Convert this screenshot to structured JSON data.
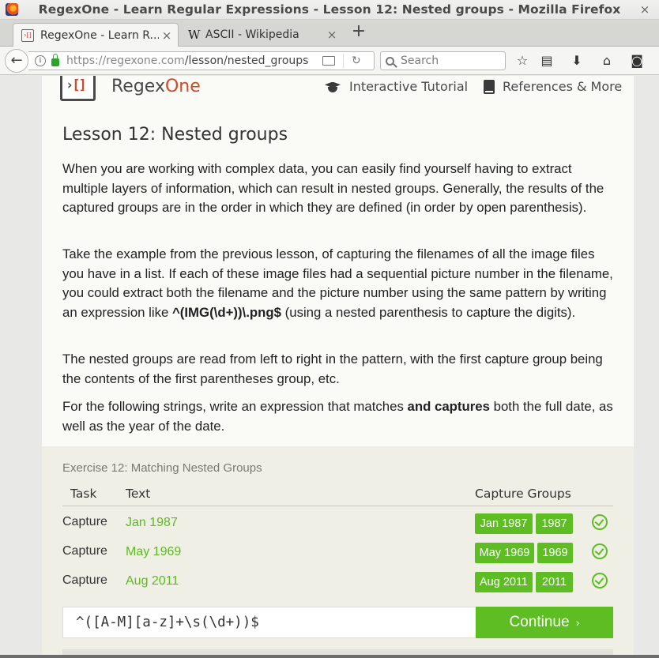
{
  "window": {
    "title": "RegexOne - Learn Regular Expressions - Lesson 12: Nested groups - Mozilla Firefox",
    "close_glyph": "×"
  },
  "tabs": [
    {
      "label": "RegexOne - Learn R...",
      "favicon": "regexone-favicon",
      "close": "×"
    },
    {
      "label": "ASCII - Wikipedia",
      "favicon": "wikipedia-favicon",
      "favicon_text": "W",
      "close": "×"
    }
  ],
  "new_tab_label": "+",
  "navbar": {
    "back_glyph": "←",
    "url_host": "https://regexone.com",
    "url_path": "/lesson/nested_groups",
    "reload_glyph": "↻",
    "search_placeholder": "Search"
  },
  "toolbar_icons": [
    "star-icon",
    "reading-list-icon",
    "download-icon",
    "home-icon",
    "pocket-icon"
  ],
  "site": {
    "logo_glyph": "›[]",
    "brand_regex": "Regex",
    "brand_one": "One",
    "nav_tutorial": "Interactive Tutorial",
    "nav_references": "References & More"
  },
  "lesson": {
    "title": "Lesson 12: Nested groups",
    "p1": "When you are working with complex data, you can easily find yourself having to extract multiple layers of information, which can result in nested groups. Generally, the results of the captured groups are in the order in which they are defined (in order by open parenthesis).",
    "p2_a": "Take the example from the previous lesson, of capturing the filenames of all the image files you have in a list. If each of these image files had a sequential picture number in the filename, you could extract both the filename and the picture number using the same pattern by writing an expression like ",
    "p2_code": "^(IMG(\\d+))\\.png$",
    "p2_b": " (using a nested parenthesis to capture the digits).",
    "p3": "The nested groups are read from left to right in the pattern, with the first capture group being the contents of the first parentheses group, etc.",
    "p4_a": "For the following strings, write an expression that matches ",
    "p4_bold": "and captures",
    "p4_b": " both the full date, as well as the year of the date."
  },
  "exercise": {
    "title": "Exercise 12: Matching Nested Groups",
    "col_task": "Task",
    "col_text": "Text",
    "col_groups": "Capture Groups",
    "rows": [
      {
        "task": "Capture",
        "text": "Jan 1987",
        "group1": "Jan 1987",
        "group2": "1987",
        "status": "check-icon"
      },
      {
        "task": "Capture",
        "text": "May 1969",
        "group1": "May 1969",
        "group2": "1969",
        "status": "check-icon"
      },
      {
        "task": "Capture",
        "text": "Aug 2011",
        "group1": "Aug 2011",
        "group2": "2011",
        "status": "check-icon"
      }
    ],
    "answer_value": "^([A-M][a-z]+\\s(\\d+))$",
    "continue_label": "Continue",
    "continue_chevron": "›"
  },
  "colors": {
    "accent_green": "#5fbd24",
    "brand_orange": "#d04a2a"
  }
}
